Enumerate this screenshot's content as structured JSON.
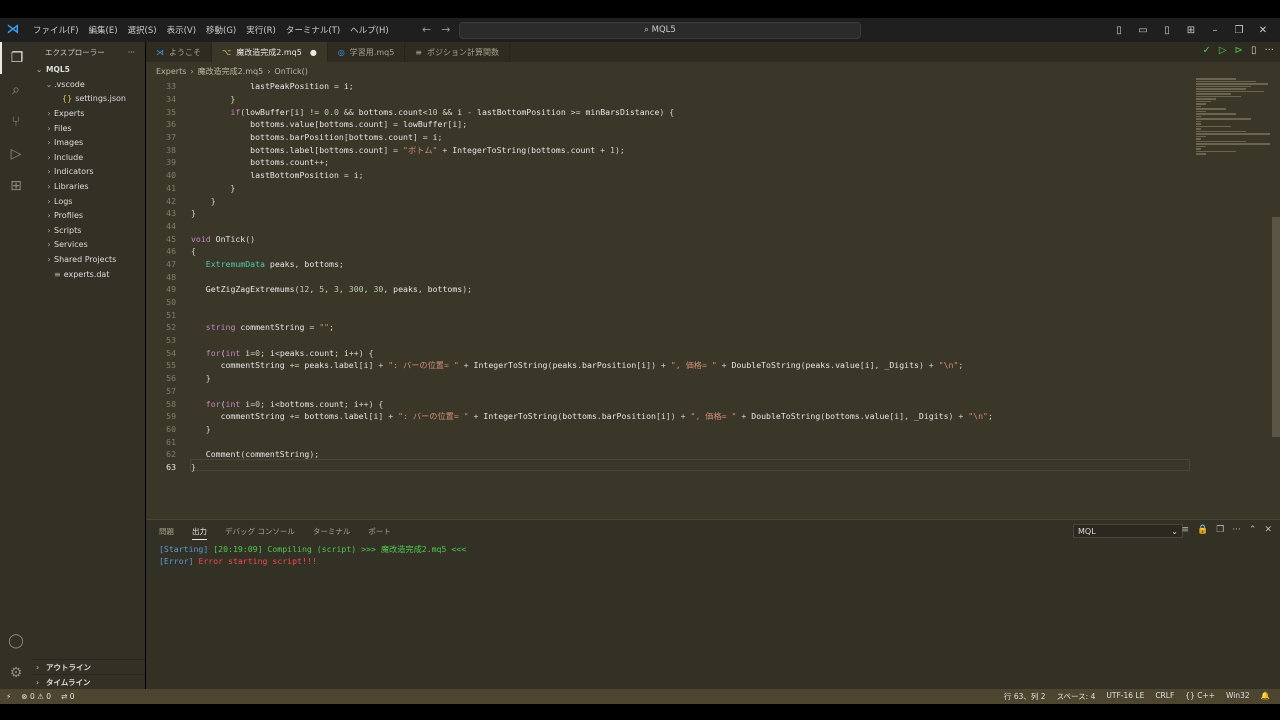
{
  "titlebar": {
    "menu": [
      "ファイル(F)",
      "編集(E)",
      "選択(S)",
      "表示(V)",
      "移動(G)",
      "実行(R)",
      "ターミナル(T)",
      "ヘルプ(H)"
    ],
    "search": "MQL5"
  },
  "sidebar": {
    "title": "エクスプローラー",
    "more": "···",
    "root": "MQL5",
    "items": [
      {
        "label": ".vscode",
        "kind": "folder-open"
      },
      {
        "label": "settings.json",
        "kind": "json"
      },
      {
        "label": "Experts",
        "kind": "folder"
      },
      {
        "label": "Files",
        "kind": "folder"
      },
      {
        "label": "Images",
        "kind": "folder"
      },
      {
        "label": "Include",
        "kind": "folder"
      },
      {
        "label": "Indicators",
        "kind": "folder"
      },
      {
        "label": "Libraries",
        "kind": "folder"
      },
      {
        "label": "Logs",
        "kind": "folder"
      },
      {
        "label": "Profiles",
        "kind": "folder"
      },
      {
        "label": "Scripts",
        "kind": "folder"
      },
      {
        "label": "Services",
        "kind": "folder"
      },
      {
        "label": "Shared Projects",
        "kind": "folder"
      },
      {
        "label": "experts.dat",
        "kind": "file"
      }
    ],
    "outline": "アウトライン",
    "timeline": "タイムライン"
  },
  "tabs": [
    {
      "label": "ようこそ",
      "active": false
    },
    {
      "label": "魔改造完成2.mq5",
      "active": true,
      "modified": true
    },
    {
      "label": "学習用.mq5",
      "active": false
    },
    {
      "label": "ポジション計算関数",
      "active": false
    }
  ],
  "breadcrumb": [
    "Experts",
    "魔改造完成2.mq5",
    "OnTick()"
  ],
  "code": [
    {
      "n": "33",
      "t": "            lastPeakPosition = i;"
    },
    {
      "n": "34",
      "t": "        }"
    },
    {
      "n": "35",
      "t": "        if(lowBuffer[i] != 0.0 && bottoms.count<10 && i - lastBottomPosition >= minBarsDistance) {"
    },
    {
      "n": "36",
      "t": "            bottoms.value[bottoms.count] = lowBuffer[i];"
    },
    {
      "n": "37",
      "t": "            bottoms.barPosition[bottoms.count] = i;"
    },
    {
      "n": "38",
      "t": "            bottoms.label[bottoms.count] = \"ボトム\" + IntegerToString(bottoms.count + 1);"
    },
    {
      "n": "39",
      "t": "            bottoms.count++;"
    },
    {
      "n": "40",
      "t": "            lastBottomPosition = i;"
    },
    {
      "n": "41",
      "t": "        }"
    },
    {
      "n": "42",
      "t": "    }"
    },
    {
      "n": "43",
      "t": "}"
    },
    {
      "n": "44",
      "t": ""
    },
    {
      "n": "45",
      "t": "void OnTick()"
    },
    {
      "n": "46",
      "t": "{"
    },
    {
      "n": "47",
      "t": "   ExtremumData peaks, bottoms;"
    },
    {
      "n": "48",
      "t": ""
    },
    {
      "n": "49",
      "t": "   GetZigZagExtremums(12, 5, 3, 300, 30, peaks, bottoms);"
    },
    {
      "n": "50",
      "t": ""
    },
    {
      "n": "51",
      "t": ""
    },
    {
      "n": "52",
      "t": "   string commentString = \"\";"
    },
    {
      "n": "53",
      "t": ""
    },
    {
      "n": "54",
      "t": "   for(int i=0; i<peaks.count; i++) {"
    },
    {
      "n": "55",
      "t": "      commentString += peaks.label[i] + \": バーの位置= \" + IntegerToString(peaks.barPosition[i]) + \", 価格= \" + DoubleToString(peaks.value[i], _Digits) + \"\\n\";"
    },
    {
      "n": "56",
      "t": "   }"
    },
    {
      "n": "57",
      "t": ""
    },
    {
      "n": "58",
      "t": "   for(int i=0; i<bottoms.count; i++) {"
    },
    {
      "n": "59",
      "t": "      commentString += bottoms.label[i] + \": バーの位置= \" + IntegerToString(bottoms.barPosition[i]) + \", 価格= \" + DoubleToString(bottoms.value[i], _Digits) + \"\\n\";"
    },
    {
      "n": "60",
      "t": "   }"
    },
    {
      "n": "61",
      "t": ""
    },
    {
      "n": "62",
      "t": "   Comment(commentString);"
    },
    {
      "n": "63",
      "t": "}"
    }
  ],
  "panel": {
    "tabs": [
      "問題",
      "出力",
      "デバッグ コンソール",
      "ターミナル",
      "ポート"
    ],
    "active_tab": "出力",
    "channel": "MQL",
    "lines": [
      {
        "prefix": "[Starting]",
        "text": " [20:19:09] Compiling (script) >>> 魔改造完成2.mq5 <<<",
        "color": "#4ec94e"
      },
      {
        "prefix": "[Error]",
        "text": " Error starting script!!!",
        "color": "#f14c4c"
      }
    ]
  },
  "status": {
    "errors": "0",
    "warnings": "0",
    "ports": "0",
    "position": "行 63、列 2",
    "spaces": "スペース: 4",
    "encoding": "UTF-16 LE",
    "eol": "CRLF",
    "language": "C++",
    "platform": "Win32"
  },
  "colors": {
    "accent": "#3b9cf0",
    "editor_bg": "#3a3628",
    "status_bg": "#4d4530"
  }
}
